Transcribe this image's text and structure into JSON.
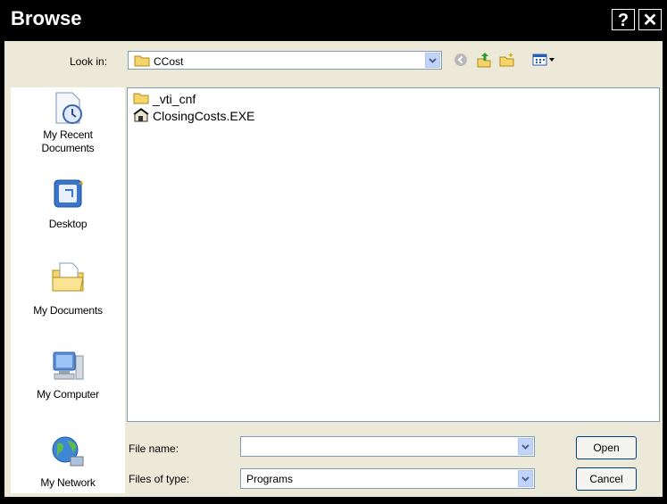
{
  "window": {
    "title": "Browse",
    "help_glyph": "?",
    "close_glyph": "✕"
  },
  "toolbar": {
    "look_in_label": "Look in:",
    "look_in_value": "CCost"
  },
  "places": [
    {
      "label": "My Recent Documents",
      "icon": "recent-documents-icon"
    },
    {
      "label": "Desktop",
      "icon": "desktop-icon"
    },
    {
      "label": "My Documents",
      "icon": "my-documents-icon"
    },
    {
      "label": "My Computer",
      "icon": "my-computer-icon"
    },
    {
      "label": "My Network",
      "icon": "my-network-icon"
    }
  ],
  "files": [
    {
      "name": "_vti_cnf",
      "icon": "folder-icon"
    },
    {
      "name": "ClosingCosts.EXE",
      "icon": "executable-icon"
    }
  ],
  "form": {
    "file_name_label": "File name:",
    "file_name_value": "",
    "files_of_type_label": "Files of type:",
    "files_of_type_value": "Programs",
    "open_label": "Open",
    "cancel_label": "Cancel"
  }
}
